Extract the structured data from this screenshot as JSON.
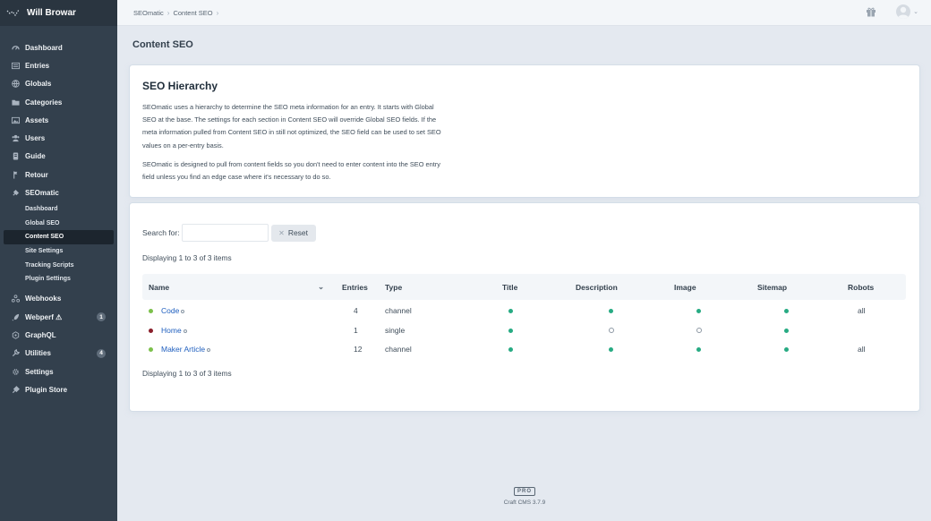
{
  "site": {
    "name": "Will Browar"
  },
  "nav": {
    "items": [
      {
        "label": "Dashboard",
        "icon": "dashboard-icon"
      },
      {
        "label": "Entries",
        "icon": "entries-icon"
      },
      {
        "label": "Globals",
        "icon": "globe-icon"
      },
      {
        "label": "Categories",
        "icon": "folder-icon"
      },
      {
        "label": "Assets",
        "icon": "image-icon"
      },
      {
        "label": "Users",
        "icon": "users-icon"
      },
      {
        "label": "Guide",
        "icon": "book-icon"
      },
      {
        "label": "Retour",
        "icon": "flag-icon"
      },
      {
        "label": "SEOmatic",
        "icon": "plug-icon"
      }
    ],
    "seomatic_sub": [
      "Dashboard",
      "Global SEO",
      "Content SEO",
      "Site Settings",
      "Tracking Scripts",
      "Plugin Settings"
    ],
    "items2": [
      {
        "label": "Webhooks",
        "icon": "webhooks-icon"
      },
      {
        "label": "Webperf ⚠",
        "icon": "rocket-icon",
        "badge": "1"
      },
      {
        "label": "GraphQL",
        "icon": "graphql-icon"
      },
      {
        "label": "Utilities",
        "icon": "wrench-icon",
        "badge": "4"
      },
      {
        "label": "Settings",
        "icon": "gear-icon"
      },
      {
        "label": "Plugin Store",
        "icon": "plug-store-icon"
      }
    ]
  },
  "breadcrumb": [
    "SEOmatic",
    "Content SEO"
  ],
  "page": {
    "title": "Content SEO",
    "hierarchy_title": "SEO Hierarchy",
    "para1": "SEOmatic uses a hierarchy to determine the SEO meta information for an entry. It starts with Global SEO at the base. The settings for each section in Content SEO will override Global SEO fields. If the meta information pulled from Content SEO in still not optimized, the SEO field can be used to set SEO values on a per-entry basis.",
    "para2": "SEOmatic is designed to pull from content fields so you don't need to enter content into the SEO entry field unless you find an edge case where it's necessary to do so."
  },
  "search": {
    "label": "Search for:",
    "value": "",
    "reset_label": "Reset"
  },
  "display_count": "Displaying 1 to 3 of 3 items",
  "table": {
    "headers": {
      "name": "Name",
      "entries": "Entries",
      "type": "Type",
      "title": "Title",
      "description": "Description",
      "image": "Image",
      "sitemap": "Sitemap",
      "robots": "Robots"
    },
    "rows": [
      {
        "name": "Code",
        "status": "#7cc04b",
        "entries": "4",
        "type": "channel",
        "title": true,
        "description": true,
        "image": true,
        "sitemap": true,
        "robots": "all"
      },
      {
        "name": "Home",
        "status": "#8a1f2b",
        "entries": "1",
        "type": "single",
        "title": true,
        "description": false,
        "image": false,
        "sitemap": true,
        "robots": ""
      },
      {
        "name": "Maker Article",
        "status": "#7cc04b",
        "entries": "12",
        "type": "channel",
        "title": true,
        "description": true,
        "image": true,
        "sitemap": true,
        "robots": "all"
      }
    ]
  },
  "footer": {
    "edition": "PRO",
    "version": "Craft CMS 3.7.9"
  },
  "colors": {
    "sidebar": "#33404d",
    "enabled": "#27ab83",
    "link": "#1f5fbf"
  }
}
